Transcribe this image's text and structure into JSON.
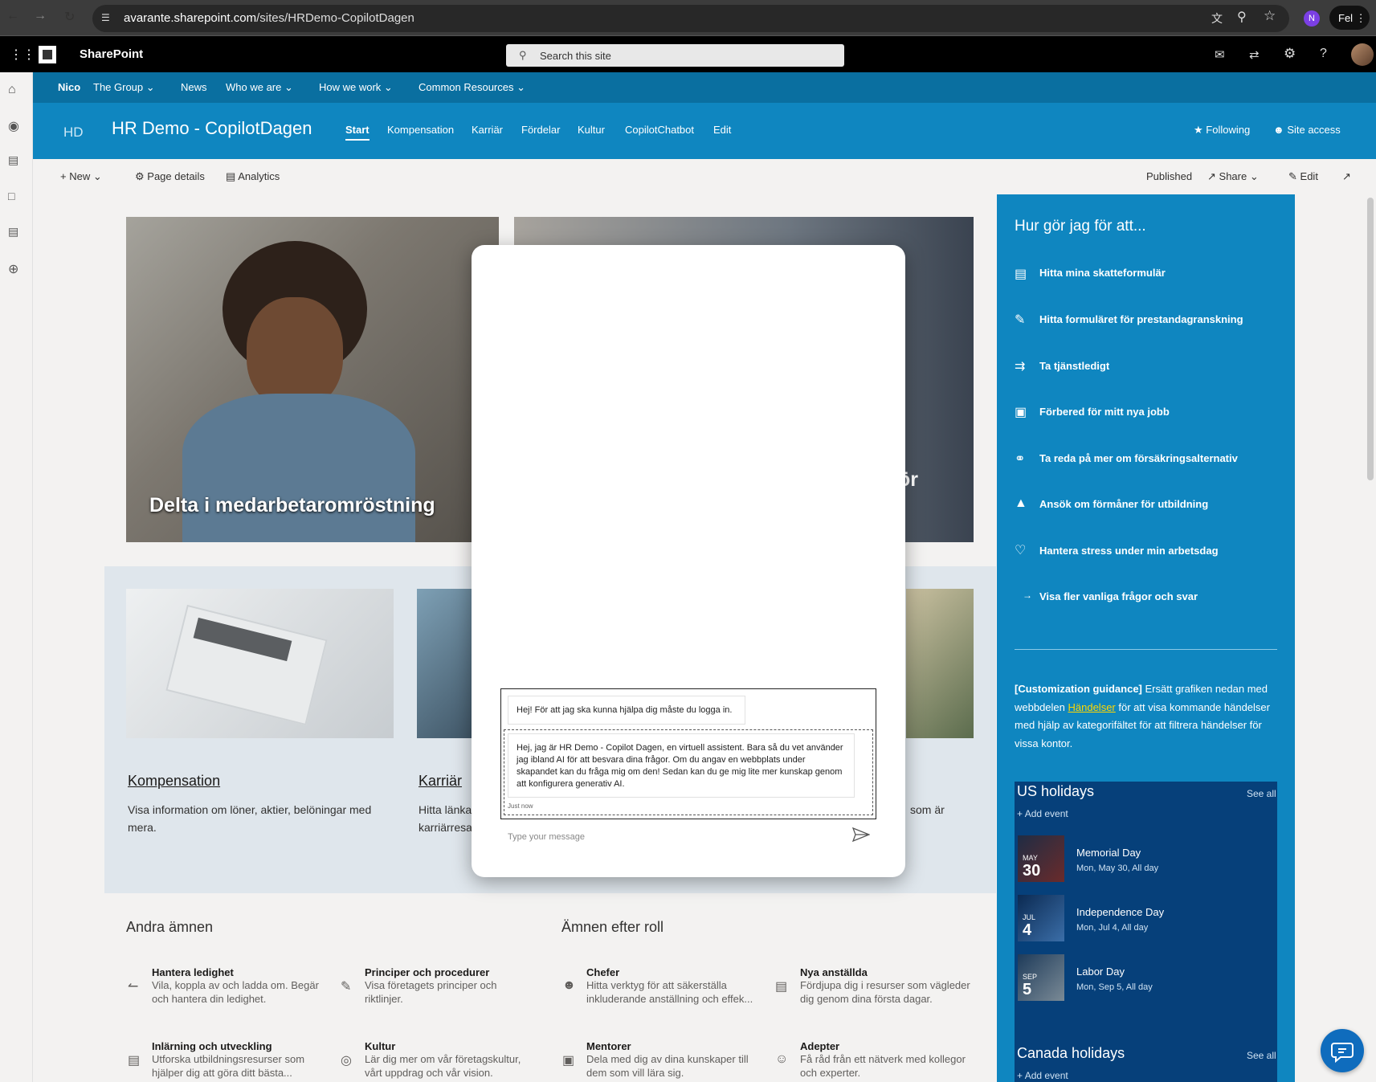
{
  "browser": {
    "url_domain": "avarante.sharepoint.com",
    "url_path": "/sites/HRDemo-CopilotDagen",
    "profile_initial": "N",
    "profile_badge": "Fel"
  },
  "suite": {
    "app_name": "SharePoint",
    "search_placeholder": "Search this site"
  },
  "hub_nav": {
    "items": [
      "Nico",
      "The Group",
      "News",
      "Who we are",
      "How we work",
      "Common Resources"
    ]
  },
  "site": {
    "logo": "HD",
    "title": "HR Demo - CopilotDagen",
    "nav": [
      "Start",
      "Kompensation",
      "Karriär",
      "Fördelar",
      "Kultur",
      "CopilotChatbot",
      "Edit"
    ],
    "following": "Following",
    "site_access": "Site access"
  },
  "command_bar": {
    "new": "New",
    "page_details": "Page details",
    "analytics": "Analytics",
    "published": "Published",
    "share": "Share",
    "edit": "Edit"
  },
  "hero": {
    "caption1": "Delta i medarbetaromröstning",
    "caption2": "ör"
  },
  "cards": [
    {
      "title": "Kompensation",
      "desc_line1": "Visa information om löner, aktier, belöningar med",
      "desc_line2": "mera."
    },
    {
      "title": "Karriär",
      "desc_line1": "Hitta länka",
      "desc_line2": "karriärresa"
    },
    {
      "desc_line1": "som är"
    }
  ],
  "other_topics": {
    "heading": "Andra ämnen",
    "items": [
      {
        "title": "Hantera ledighet",
        "desc1": "Vila, koppla av och ladda om. Begär",
        "desc2": "och hantera din ledighet."
      },
      {
        "title": "Principer och procedurer",
        "desc1": "Visa företagets principer och",
        "desc2": "riktlinjer."
      },
      {
        "title": "Inlärning och utveckling",
        "desc1": "Utforska utbildningsresurser som",
        "desc2": "hjälper dig att göra ditt bästa..."
      },
      {
        "title": "Kultur",
        "desc1": "Lär dig mer om vår företagskultur,",
        "desc2": "vårt uppdrag och vår vision."
      }
    ]
  },
  "role_topics": {
    "heading": "Ämnen efter roll",
    "items": [
      {
        "title": "Chefer",
        "desc1": "Hitta verktyg för att säkerställa",
        "desc2": "inkluderande anställning och effek..."
      },
      {
        "title": "Nya anställda",
        "desc1": "Fördjupa dig i resurser som vägleder",
        "desc2": "dig genom dina första dagar."
      },
      {
        "title": "Mentorer",
        "desc1": "Dela med dig av dina kunskaper till",
        "desc2": "dem som vill lära sig."
      },
      {
        "title": "Adepter",
        "desc1": "Få råd från ett nätverk med kollegor",
        "desc2": "och experter."
      }
    ]
  },
  "quick_links": {
    "title": "Hur gör jag för att...",
    "items": [
      "Hitta mina skatteformulär",
      "Hitta formuläret för prestandagranskning",
      "Ta tjänstledigt",
      "Förbered för mitt nya jobb",
      "Ta reda på mer om försäkringsalternativ",
      "Ansök om förmåner för utbildning",
      "Hantera stress under min arbetsdag",
      "Visa fler vanliga frågor och svar"
    ]
  },
  "guidance": {
    "bold": "[Customization guidance]",
    "text1": " Ersätt grafiken nedan med webbdelen ",
    "link": "Händelser",
    "text2": " för att visa kommande händelser med hjälp av kategorifältet för att filtrera händelser för vissa kontor."
  },
  "holidays": {
    "us_title": "US holidays",
    "see_all": "See all",
    "add_event": "Add event",
    "events": [
      {
        "month": "MAY",
        "day": "30",
        "name": "Memorial Day",
        "sub": "Mon, May 30, All day"
      },
      {
        "month": "JUL",
        "day": "4",
        "name": "Independence Day",
        "sub": "Mon, Jul 4, All day"
      },
      {
        "month": "SEP",
        "day": "5",
        "name": "Labor Day",
        "sub": "Mon, Sep 5, All day"
      }
    ],
    "canada_title": "Canada holidays"
  },
  "chat": {
    "message1": "Hej! För att jag ska kunna hjälpa dig måste du logga in.",
    "message2": "Hej, jag är HR Demo - Copilot Dagen, en virtuell assistent. Bara så du vet använder jag ibland AI för att besvara dina frågor. Om du angav en webbplats under skapandet kan du fråga mig om den! Sedan kan du ge mig lite mer kunskap genom att konfigurera generativ AI.",
    "timestamp": "Just now",
    "input_placeholder": "Type your message"
  },
  "colors": {
    "site_header": "#0f86c0",
    "hub_nav": "#0a6fa0",
    "holiday_panel": "#06407a",
    "suite_bar": "#000000"
  }
}
